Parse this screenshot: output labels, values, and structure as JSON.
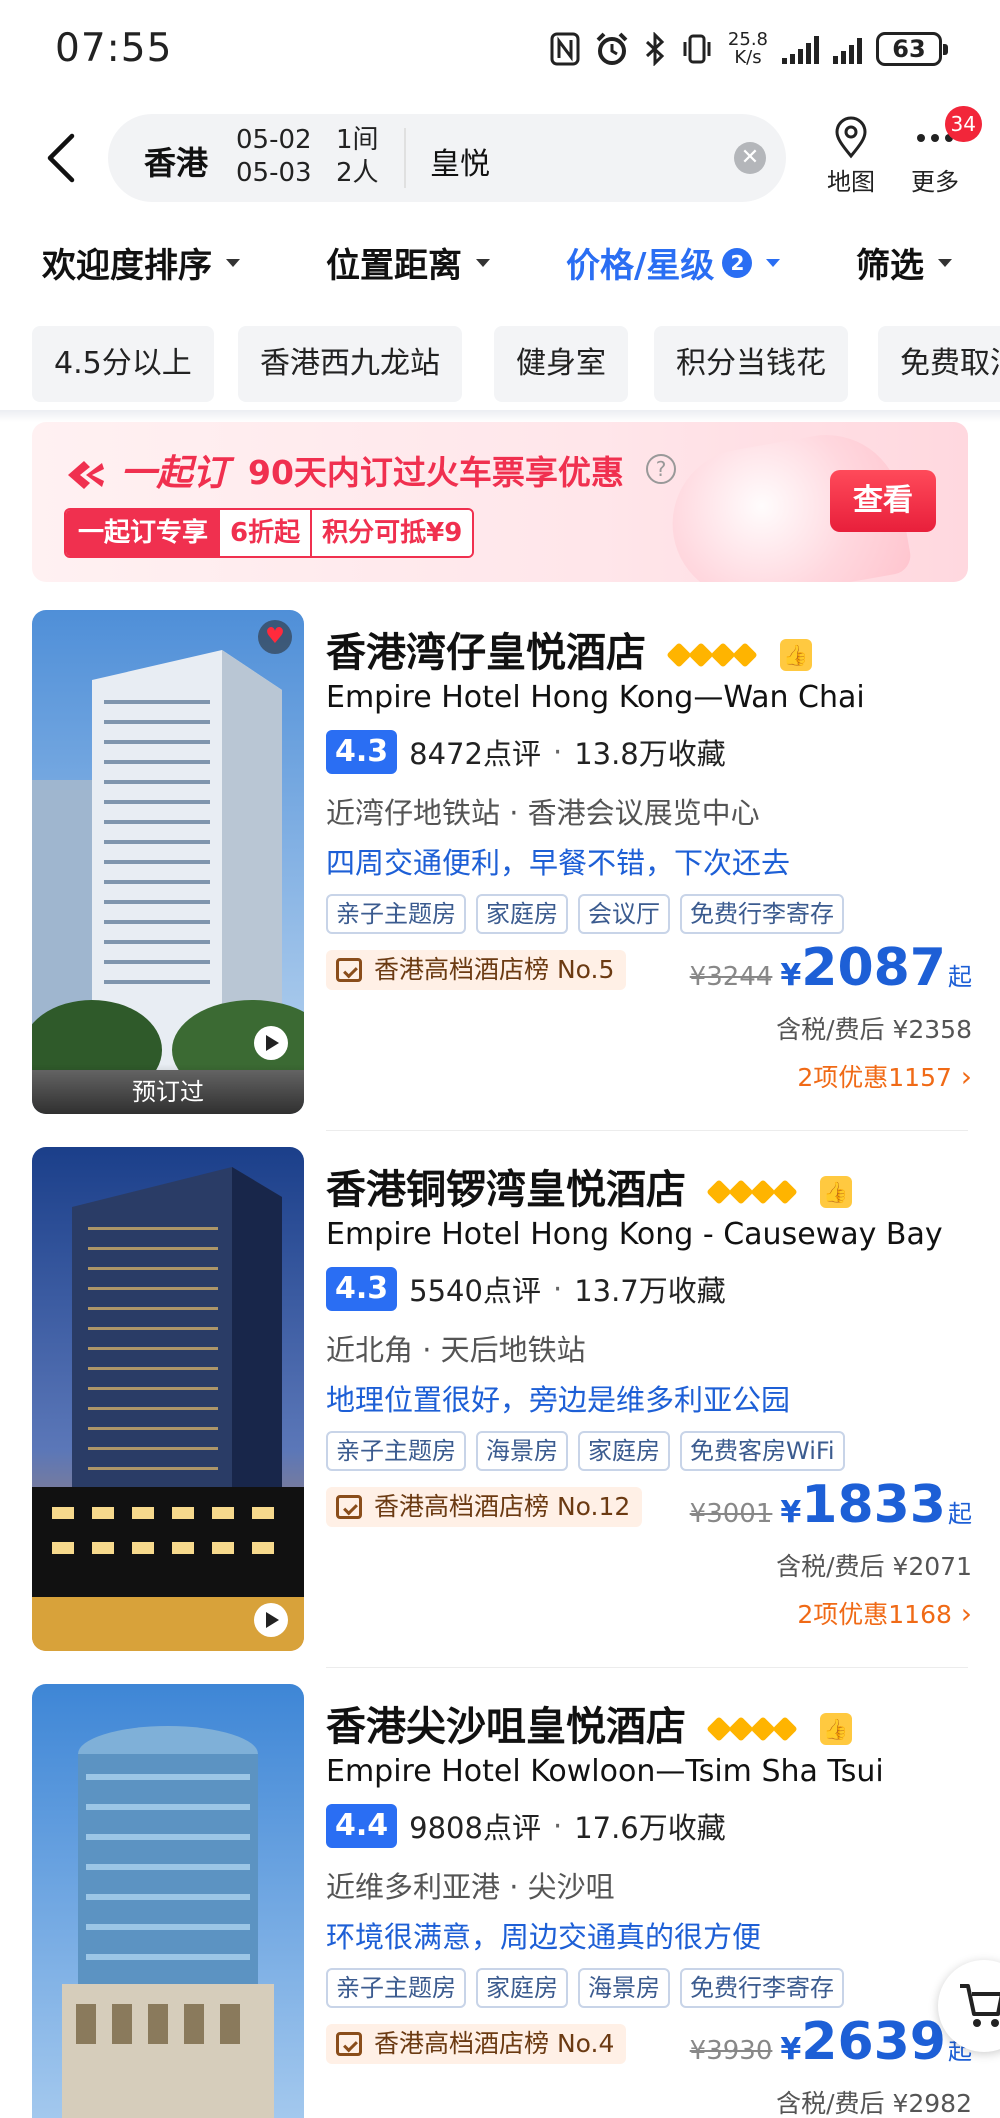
{
  "status_bar": {
    "time": "07:55",
    "net_speed_value": "25.8",
    "net_speed_unit": "K/s",
    "battery": "63",
    "icons": [
      "nfc-icon",
      "alarm-icon",
      "bluetooth-icon",
      "vibrate-icon",
      "signal-icon",
      "battery-icon"
    ]
  },
  "search": {
    "city": "香港",
    "checkin": "05-02",
    "checkout": "05-03",
    "rooms": "1间",
    "guests": "2人",
    "keyword": "皇悦"
  },
  "header": {
    "map_label": "地图",
    "more_label": "更多",
    "more_badge": "34"
  },
  "sort_bar": {
    "items": [
      {
        "label": "欢迎度排序"
      },
      {
        "label": "位置距离"
      },
      {
        "label": "价格/星级",
        "count": "2",
        "active": true
      },
      {
        "label": "筛选"
      }
    ]
  },
  "chips": [
    "4.5分以上",
    "香港西九龙站",
    "健身室",
    "积分当钱花",
    "免费取消"
  ],
  "promo": {
    "brand": "一起订",
    "title": "90天内订过火车票享优惠",
    "tag_1": "一起订专享",
    "tag_2": "6折起",
    "tag_3": "积分可抵¥9",
    "button": "查看",
    "accent": "#f0304f"
  },
  "hotels": [
    {
      "name": "香港湾仔皇悦酒店",
      "name_en": "Empire Hotel Hong Kong—Wan Chai",
      "score": "4.3",
      "reviews": "8472点评",
      "favorites": "13.8万收藏",
      "location": "近湾仔地铁站 · 香港会议展览中心",
      "highlight": "四周交通便利，早餐不错，下次还去",
      "tags": [
        "亲子主题房",
        "家庭房",
        "会议厅",
        "免费行李寄存"
      ],
      "rank": "香港高档酒店榜 No.5",
      "original_price": "¥3244",
      "currency": "¥",
      "price": "2087",
      "price_suffix": "起",
      "after_tax": "含税/费后 ¥2358",
      "discount": "2项优惠1157",
      "booked_label": "预订过",
      "favorited": true
    },
    {
      "name": "香港铜锣湾皇悦酒店",
      "name_en": "Empire Hotel Hong Kong - Causeway Bay",
      "score": "4.3",
      "reviews": "5540点评",
      "favorites": "13.7万收藏",
      "location": "近北角 · 天后地铁站",
      "highlight": "地理位置很好，旁边是维多利亚公园",
      "tags": [
        "亲子主题房",
        "海景房",
        "家庭房",
        "免费客房WiFi"
      ],
      "rank": "香港高档酒店榜 No.12",
      "original_price": "¥3001",
      "currency": "¥",
      "price": "1833",
      "price_suffix": "起",
      "after_tax": "含税/费后 ¥2071",
      "discount": "2项优惠1168"
    },
    {
      "name": "香港尖沙咀皇悦酒店",
      "name_en": "Empire Hotel Kowloon—Tsim Sha Tsui",
      "score": "4.4",
      "reviews": "9808点评",
      "favorites": "17.6万收藏",
      "location": "近维多利亚港 · 尖沙咀",
      "highlight": "环境很满意，周边交通真的很方便",
      "tags": [
        "亲子主题房",
        "家庭房",
        "海景房",
        "免费行李寄存"
      ],
      "rank": "香港高档酒店榜 No.4",
      "original_price": "¥3930",
      "currency": "¥",
      "price": "2639",
      "price_suffix": "起",
      "after_tax": "含税/费后 ¥2982"
    }
  ],
  "colors": {
    "primary_blue": "#2a6ef3",
    "price_blue": "#1d5fd6",
    "discount_orange": "#f06a16",
    "diamond_gold": "#ffb400"
  }
}
